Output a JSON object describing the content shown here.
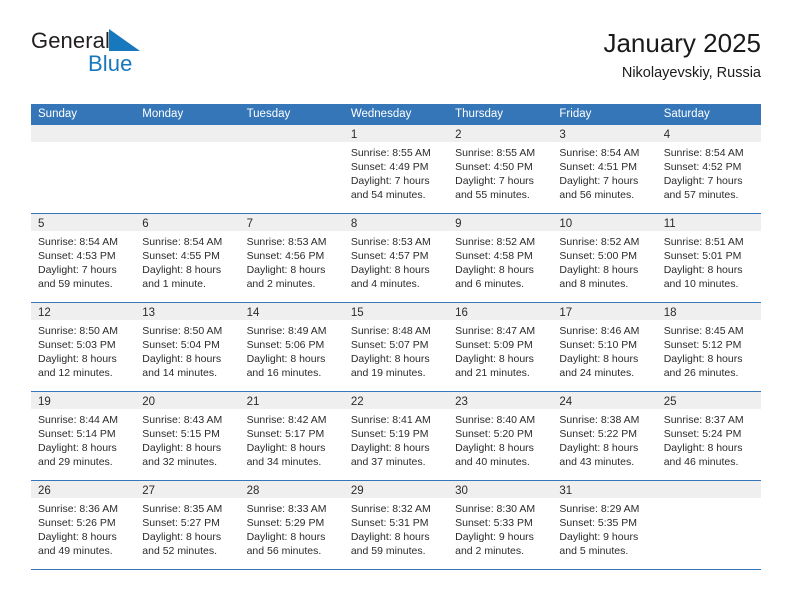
{
  "brand": {
    "name_part1": "General",
    "name_part2": "Blue",
    "triangle_color": "#1878be",
    "text_color": "#231f20"
  },
  "header": {
    "title": "January 2025",
    "subtitle": "Nikolayevskiy, Russia"
  },
  "theme": {
    "header_blue": "#3476b8",
    "day_band_gray": "#efefef",
    "text_dark": "#2b2b2b"
  },
  "weekday_headers": [
    "Sunday",
    "Monday",
    "Tuesday",
    "Wednesday",
    "Thursday",
    "Friday",
    "Saturday"
  ],
  "weeks": [
    [
      {
        "day": "",
        "empty": true,
        "lines": []
      },
      {
        "day": "",
        "empty": true,
        "lines": []
      },
      {
        "day": "",
        "empty": true,
        "lines": []
      },
      {
        "day": "1",
        "empty": false,
        "lines": [
          "Sunrise: 8:55 AM",
          "Sunset: 4:49 PM",
          "Daylight: 7 hours",
          "and 54 minutes."
        ]
      },
      {
        "day": "2",
        "empty": false,
        "lines": [
          "Sunrise: 8:55 AM",
          "Sunset: 4:50 PM",
          "Daylight: 7 hours",
          "and 55 minutes."
        ]
      },
      {
        "day": "3",
        "empty": false,
        "lines": [
          "Sunrise: 8:54 AM",
          "Sunset: 4:51 PM",
          "Daylight: 7 hours",
          "and 56 minutes."
        ]
      },
      {
        "day": "4",
        "empty": false,
        "lines": [
          "Sunrise: 8:54 AM",
          "Sunset: 4:52 PM",
          "Daylight: 7 hours",
          "and 57 minutes."
        ]
      }
    ],
    [
      {
        "day": "5",
        "empty": false,
        "lines": [
          "Sunrise: 8:54 AM",
          "Sunset: 4:53 PM",
          "Daylight: 7 hours",
          "and 59 minutes."
        ]
      },
      {
        "day": "6",
        "empty": false,
        "lines": [
          "Sunrise: 8:54 AM",
          "Sunset: 4:55 PM",
          "Daylight: 8 hours",
          "and 1 minute."
        ]
      },
      {
        "day": "7",
        "empty": false,
        "lines": [
          "Sunrise: 8:53 AM",
          "Sunset: 4:56 PM",
          "Daylight: 8 hours",
          "and 2 minutes."
        ]
      },
      {
        "day": "8",
        "empty": false,
        "lines": [
          "Sunrise: 8:53 AM",
          "Sunset: 4:57 PM",
          "Daylight: 8 hours",
          "and 4 minutes."
        ]
      },
      {
        "day": "9",
        "empty": false,
        "lines": [
          "Sunrise: 8:52 AM",
          "Sunset: 4:58 PM",
          "Daylight: 8 hours",
          "and 6 minutes."
        ]
      },
      {
        "day": "10",
        "empty": false,
        "lines": [
          "Sunrise: 8:52 AM",
          "Sunset: 5:00 PM",
          "Daylight: 8 hours",
          "and 8 minutes."
        ]
      },
      {
        "day": "11",
        "empty": false,
        "lines": [
          "Sunrise: 8:51 AM",
          "Sunset: 5:01 PM",
          "Daylight: 8 hours",
          "and 10 minutes."
        ]
      }
    ],
    [
      {
        "day": "12",
        "empty": false,
        "lines": [
          "Sunrise: 8:50 AM",
          "Sunset: 5:03 PM",
          "Daylight: 8 hours",
          "and 12 minutes."
        ]
      },
      {
        "day": "13",
        "empty": false,
        "lines": [
          "Sunrise: 8:50 AM",
          "Sunset: 5:04 PM",
          "Daylight: 8 hours",
          "and 14 minutes."
        ]
      },
      {
        "day": "14",
        "empty": false,
        "lines": [
          "Sunrise: 8:49 AM",
          "Sunset: 5:06 PM",
          "Daylight: 8 hours",
          "and 16 minutes."
        ]
      },
      {
        "day": "15",
        "empty": false,
        "lines": [
          "Sunrise: 8:48 AM",
          "Sunset: 5:07 PM",
          "Daylight: 8 hours",
          "and 19 minutes."
        ]
      },
      {
        "day": "16",
        "empty": false,
        "lines": [
          "Sunrise: 8:47 AM",
          "Sunset: 5:09 PM",
          "Daylight: 8 hours",
          "and 21 minutes."
        ]
      },
      {
        "day": "17",
        "empty": false,
        "lines": [
          "Sunrise: 8:46 AM",
          "Sunset: 5:10 PM",
          "Daylight: 8 hours",
          "and 24 minutes."
        ]
      },
      {
        "day": "18",
        "empty": false,
        "lines": [
          "Sunrise: 8:45 AM",
          "Sunset: 5:12 PM",
          "Daylight: 8 hours",
          "and 26 minutes."
        ]
      }
    ],
    [
      {
        "day": "19",
        "empty": false,
        "lines": [
          "Sunrise: 8:44 AM",
          "Sunset: 5:14 PM",
          "Daylight: 8 hours",
          "and 29 minutes."
        ]
      },
      {
        "day": "20",
        "empty": false,
        "lines": [
          "Sunrise: 8:43 AM",
          "Sunset: 5:15 PM",
          "Daylight: 8 hours",
          "and 32 minutes."
        ]
      },
      {
        "day": "21",
        "empty": false,
        "lines": [
          "Sunrise: 8:42 AM",
          "Sunset: 5:17 PM",
          "Daylight: 8 hours",
          "and 34 minutes."
        ]
      },
      {
        "day": "22",
        "empty": false,
        "lines": [
          "Sunrise: 8:41 AM",
          "Sunset: 5:19 PM",
          "Daylight: 8 hours",
          "and 37 minutes."
        ]
      },
      {
        "day": "23",
        "empty": false,
        "lines": [
          "Sunrise: 8:40 AM",
          "Sunset: 5:20 PM",
          "Daylight: 8 hours",
          "and 40 minutes."
        ]
      },
      {
        "day": "24",
        "empty": false,
        "lines": [
          "Sunrise: 8:38 AM",
          "Sunset: 5:22 PM",
          "Daylight: 8 hours",
          "and 43 minutes."
        ]
      },
      {
        "day": "25",
        "empty": false,
        "lines": [
          "Sunrise: 8:37 AM",
          "Sunset: 5:24 PM",
          "Daylight: 8 hours",
          "and 46 minutes."
        ]
      }
    ],
    [
      {
        "day": "26",
        "empty": false,
        "lines": [
          "Sunrise: 8:36 AM",
          "Sunset: 5:26 PM",
          "Daylight: 8 hours",
          "and 49 minutes."
        ]
      },
      {
        "day": "27",
        "empty": false,
        "lines": [
          "Sunrise: 8:35 AM",
          "Sunset: 5:27 PM",
          "Daylight: 8 hours",
          "and 52 minutes."
        ]
      },
      {
        "day": "28",
        "empty": false,
        "lines": [
          "Sunrise: 8:33 AM",
          "Sunset: 5:29 PM",
          "Daylight: 8 hours",
          "and 56 minutes."
        ]
      },
      {
        "day": "29",
        "empty": false,
        "lines": [
          "Sunrise: 8:32 AM",
          "Sunset: 5:31 PM",
          "Daylight: 8 hours",
          "and 59 minutes."
        ]
      },
      {
        "day": "30",
        "empty": false,
        "lines": [
          "Sunrise: 8:30 AM",
          "Sunset: 5:33 PM",
          "Daylight: 9 hours",
          "and 2 minutes."
        ]
      },
      {
        "day": "31",
        "empty": false,
        "lines": [
          "Sunrise: 8:29 AM",
          "Sunset: 5:35 PM",
          "Daylight: 9 hours",
          "and 5 minutes."
        ]
      },
      {
        "day": "",
        "empty": true,
        "lines": []
      }
    ]
  ]
}
